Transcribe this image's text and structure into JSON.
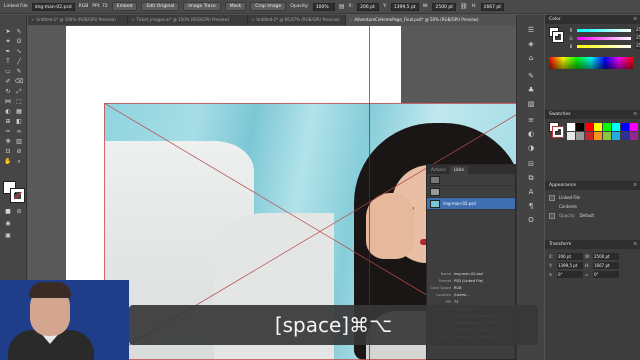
{
  "control_bar": {
    "selection_type": "Linked File",
    "file_name": "img-man-02.psd",
    "color_mode": "RGB",
    "ppi": "PPI: 72",
    "buttons": [
      "Embed",
      "Edit Original",
      "Image Trace",
      "Mask",
      "Crop Image"
    ],
    "opacity_label": "Opacity:",
    "opacity_value": "100%",
    "x_label": "X:",
    "x_value": "206 pt",
    "y_label": "Y:",
    "y_value": "1399,5 pt",
    "w_label": "W:",
    "w_value": "2500 pt",
    "h_label": "H:",
    "h_value": "1667 pt"
  },
  "tabs": [
    {
      "label": "Untitled-1* @ 100% (RGB/GPU Preview)",
      "active": false
    },
    {
      "label": "Ticket_images.ai* @ 150% (RGB/GPU Preview)",
      "active": false
    },
    {
      "label": "Untitled-2* @ 66,67% (RGB/GPU Preview)",
      "active": false
    },
    {
      "label": "AdventureCoHomePage_Final.psd* @ 50% (RGB/GPU Preview)",
      "active": true
    }
  ],
  "links_panel": {
    "tabs": [
      "Actions",
      "Links"
    ],
    "items": [
      {
        "name": "",
        "selected": false
      },
      {
        "name": "",
        "selected": false
      },
      {
        "name": "img-man-02.psd",
        "selected": true
      }
    ],
    "info": [
      {
        "k": "Name",
        "v": "img-man-02.psd"
      },
      {
        "k": "Format",
        "v": "PSD (Linked File)"
      },
      {
        "k": "Color Space",
        "v": "RGB"
      },
      {
        "k": "Location",
        "v": "/Users/..."
      },
      {
        "k": "PPI",
        "v": "72"
      },
      {
        "k": "Dimensions",
        "v": "2500x1667"
      },
      {
        "k": "Scale",
        "v": "100%, 100%, Rotate: 0°"
      },
      {
        "k": "Size",
        "v": "9495885 bytes (9,1 MB)"
      },
      {
        "k": "Created",
        "v": "13 Dec 2017, 18:05:16"
      },
      {
        "k": "Modified",
        "v": "13 Dec 2017, 18:05:16"
      }
    ]
  },
  "color_panel": {
    "title": "Color",
    "sliders": [
      {
        "label": "R",
        "value": "255"
      },
      {
        "label": "G",
        "value": "255"
      },
      {
        "label": "B",
        "value": "255"
      }
    ]
  },
  "swatches_panel": {
    "title": "Swatches"
  },
  "appearance_panel": {
    "title": "Appearance",
    "item_label": "Linked File",
    "contents_label": "Contents",
    "opacity_label": "Opacity:",
    "opacity_value": "Default"
  },
  "transform_panel": {
    "title": "Transform",
    "x_label": "X:",
    "x_value": "206 pt",
    "y_label": "Y:",
    "y_value": "1399,5 pt",
    "w_label": "W:",
    "w_value": "2500 pt",
    "h_label": "H:",
    "h_value": "1667 pt",
    "rotate_value": "0°",
    "shear_value": "0°"
  },
  "caption": {
    "text": "[space]⌘⌥"
  },
  "colors": {
    "accent": "#3f6fb0",
    "ui_dark": "#3d3d3d",
    "photo_bg": "#8fd4e0"
  }
}
